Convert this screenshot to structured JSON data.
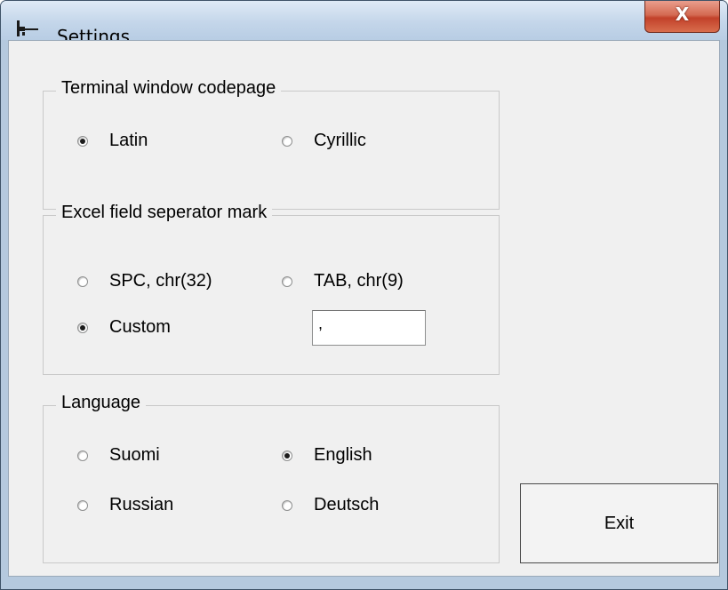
{
  "window": {
    "title": "Settings",
    "close_label": "X"
  },
  "terminal_codepage": {
    "legend": "Terminal window codepage",
    "options": [
      {
        "label": "Latin",
        "checked": true
      },
      {
        "label": "Cyrillic",
        "checked": false
      }
    ]
  },
  "excel_separator": {
    "legend": "Excel field seperator mark",
    "options": [
      {
        "label": "SPC, chr(32)",
        "checked": false
      },
      {
        "label": "TAB, chr(9)",
        "checked": false
      },
      {
        "label": "Custom",
        "checked": true
      }
    ],
    "custom_value": ","
  },
  "language": {
    "legend": "Language",
    "options": [
      {
        "label": "Suomi",
        "checked": false
      },
      {
        "label": "English",
        "checked": true
      },
      {
        "label": "Russian",
        "checked": false
      },
      {
        "label": "Deutsch",
        "checked": false
      }
    ]
  },
  "buttons": {
    "exit_label": "Exit"
  }
}
